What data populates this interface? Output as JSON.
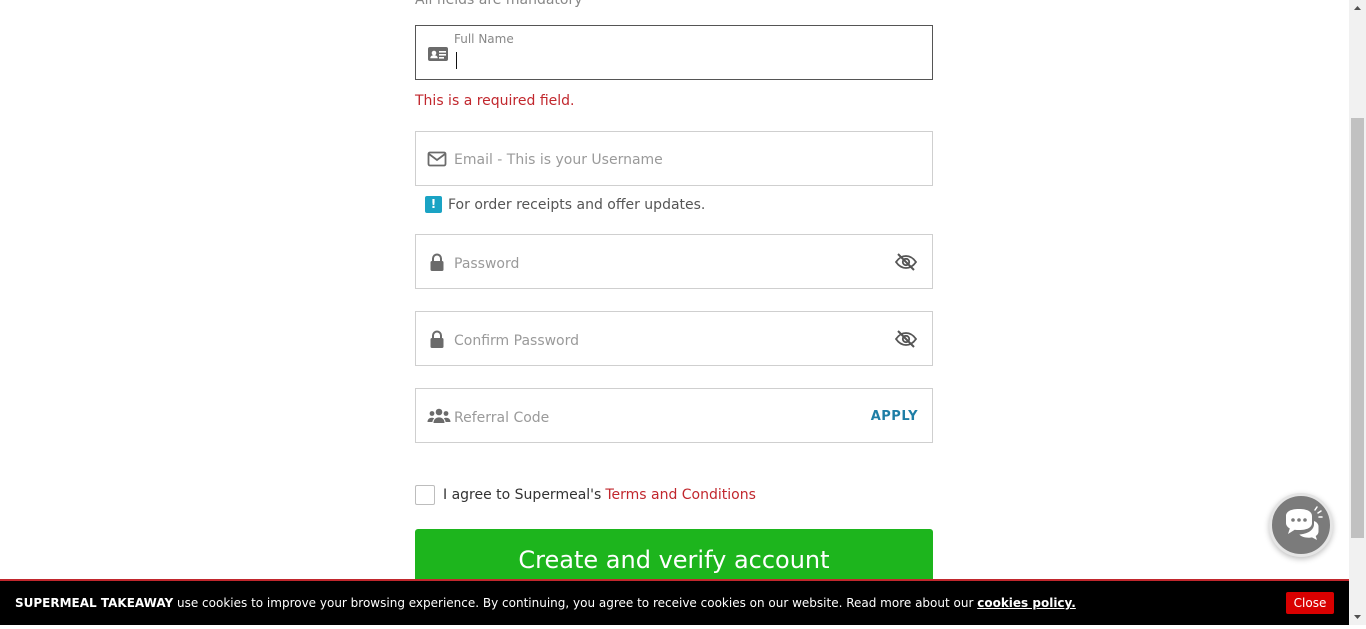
{
  "form": {
    "mandatory_note": "All fields are mandatory",
    "full_name": {
      "label": "Full Name",
      "value": ""
    },
    "full_name_error": "This is a required field.",
    "email": {
      "placeholder": "Email - This is your Username",
      "hint": "For order receipts and offer updates.",
      "hint_badge": "!"
    },
    "password": {
      "placeholder": "Password"
    },
    "confirm_password": {
      "placeholder": "Confirm Password"
    },
    "referral": {
      "placeholder": "Referral Code",
      "apply_label": "APPLY"
    },
    "terms": {
      "prefix": "I agree to Supermeal's",
      "link": "Terms and Conditions"
    },
    "submit_label": "Create and verify account"
  },
  "cookie_bar": {
    "brand": "SUPERMEAL TAKEAWAY",
    "text": " use cookies to improve your browsing experience. By continuing, you agree to receive cookies on our website. Read more about our ",
    "link": "cookies policy.",
    "close_label": "Close"
  },
  "colors": {
    "accent_red": "#c1272d",
    "button_green": "#1db51d",
    "info_blue": "#1aa3c4",
    "apply_blue": "#1e7ea6"
  },
  "icons": {
    "full_name": "id-card-icon",
    "email": "envelope-icon",
    "password": "lock-icon",
    "visibility": "eye-slash-icon",
    "referral": "users-icon",
    "chat": "chat-bubbles-icon"
  }
}
